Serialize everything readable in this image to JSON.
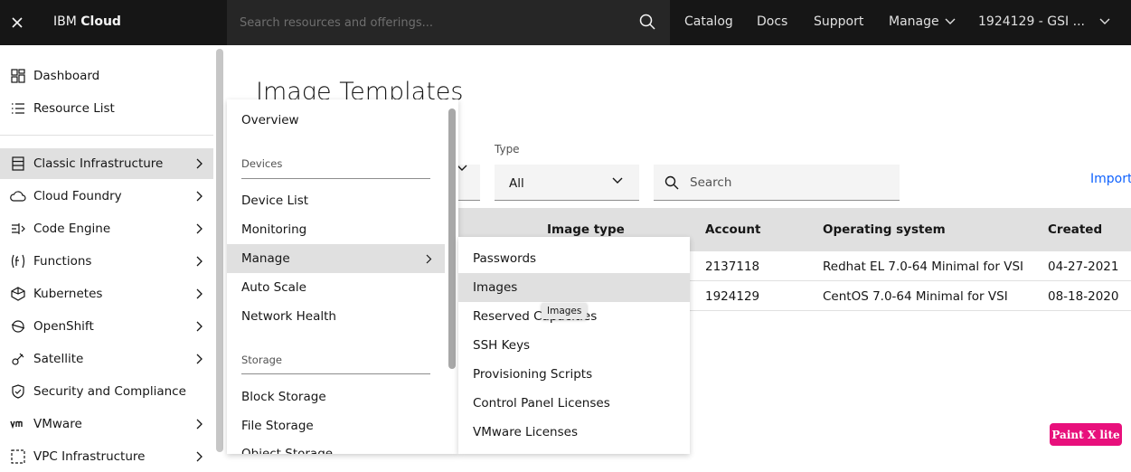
{
  "topbar": {
    "brand_prefix": "IBM ",
    "brand_bold": "Cloud",
    "search_placeholder": "Search resources and offerings...",
    "links": [
      "Catalog",
      "Docs",
      "Support",
      "Manage"
    ],
    "account": "1924129 - GSI ..."
  },
  "sidebar": {
    "items": [
      {
        "label": "Dashboard",
        "icon": "dashboard-icon"
      },
      {
        "label": "Resource List",
        "icon": "list-icon"
      },
      {
        "label": "Classic Infrastructure",
        "icon": "server-icon"
      },
      {
        "label": "Cloud Foundry",
        "icon": "cloud-icon"
      },
      {
        "label": "Code Engine",
        "icon": "code-engine-icon"
      },
      {
        "label": "Functions",
        "icon": "functions-icon"
      },
      {
        "label": "Kubernetes",
        "icon": "kubernetes-icon"
      },
      {
        "label": "OpenShift",
        "icon": "openshift-icon"
      },
      {
        "label": "Satellite",
        "icon": "satellite-icon"
      },
      {
        "label": "Security and Compliance",
        "icon": "shield-icon"
      },
      {
        "label": "VMware",
        "icon": "vmware-icon"
      },
      {
        "label": "VPC Infrastructure",
        "icon": "vpc-icon"
      }
    ]
  },
  "page": {
    "title": "Image Templates",
    "type_label": "Type",
    "type_value": "All",
    "search_placeholder": "Search",
    "import_link": "Import"
  },
  "table": {
    "headers": [
      "Image type",
      "Account",
      "Operating system",
      "Created"
    ],
    "rows": [
      {
        "account": "2137118",
        "os": "Redhat EL 7.0-64 Minimal for VSI",
        "created": "04-27-2021"
      },
      {
        "account": "1924129",
        "os": "CentOS 7.0-64 Minimal for VSI",
        "created": "08-18-2020"
      }
    ]
  },
  "flyout1": {
    "overview": "Overview",
    "devices_section": "Devices",
    "device_list": "Device List",
    "monitoring": "Monitoring",
    "manage": "Manage",
    "auto_scale": "Auto Scale",
    "network_health": "Network Health",
    "storage_section": "Storage",
    "block_storage": "Block Storage",
    "file_storage": "File Storage",
    "object_storage": "Object Storage"
  },
  "flyout2": {
    "items": [
      "Passwords",
      "Images",
      "Reserved Capacities",
      "SSH Keys",
      "Provisioning Scripts",
      "Control Panel Licenses",
      "VMware Licenses"
    ],
    "tooltip": "Images"
  },
  "badge": "Paint X lite",
  "colors": {
    "topbar": "#161616",
    "link": "#0f62fe",
    "active_bg": "#e0e0e0",
    "badge": "#e8107c"
  }
}
